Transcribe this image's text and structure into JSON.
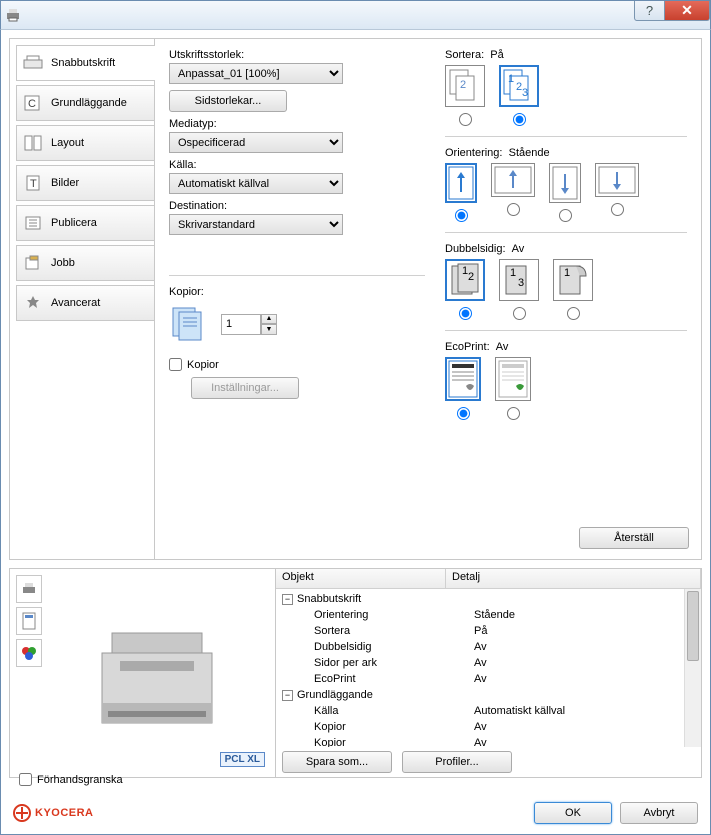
{
  "title": " ",
  "tabs": {
    "quick": "Snabbutskrift",
    "basic": "Grundläggande",
    "layout": "Layout",
    "images": "Bilder",
    "publish": "Publicera",
    "job": "Jobb",
    "advanced": "Avancerat"
  },
  "left": {
    "printsize_lbl": "Utskriftsstorlek:",
    "printsize_val": "Anpassat_01 [100%]",
    "pagesizes_btn": "Sidstorlekar...",
    "mediatype_lbl": "Mediatyp:",
    "mediatype_val": "Ospecificerad",
    "source_lbl": "Källa:",
    "source_val": "Automatiskt källval",
    "dest_lbl": "Destination:",
    "dest_val": "Skrivarstandard",
    "copies_lbl": "Kopior:",
    "copies_val": "1",
    "copies_chk": "Kopior",
    "settings_btn": "Inställningar..."
  },
  "right": {
    "sort_lbl": "Sortera:",
    "sort_val": "På",
    "orient_lbl": "Orientering:",
    "orient_val": "Stående",
    "duplex_lbl": "Dubbelsidig:",
    "duplex_val": "Av",
    "eco_lbl": "EcoPrint:",
    "eco_val": "Av",
    "reset_btn": "Återställ"
  },
  "lower": {
    "col_object": "Objekt",
    "col_detail": "Detalj",
    "groups": [
      {
        "name": "Snabbutskrift",
        "rows": [
          {
            "k": "Orientering",
            "v": "Stående"
          },
          {
            "k": "Sortera",
            "v": "På"
          },
          {
            "k": "Dubbelsidig",
            "v": "Av"
          },
          {
            "k": "Sidor per ark",
            "v": "Av"
          },
          {
            "k": "EcoPrint",
            "v": "Av"
          }
        ]
      },
      {
        "name": "Grundläggande",
        "rows": [
          {
            "k": "Källa",
            "v": "Automatiskt källval"
          },
          {
            "k": "Kopior",
            "v": "Av"
          },
          {
            "k": "Kopior",
            "v": "Av"
          }
        ]
      }
    ],
    "pcl": "PCL XL",
    "save_as": "Spara som...",
    "profiles": "Profiler..."
  },
  "preview_chk": "Förhandsgranska",
  "brand": "KYOCERA",
  "ok": "OK",
  "cancel": "Avbryt"
}
